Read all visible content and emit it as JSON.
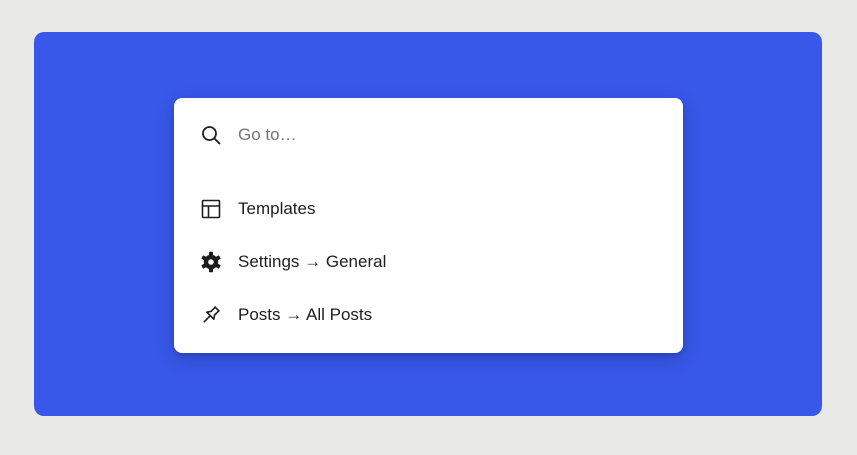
{
  "command_palette": {
    "search": {
      "placeholder": "Go to…",
      "value": ""
    },
    "results": [
      {
        "label": "Templates",
        "icon": "layout-icon"
      },
      {
        "label": "Settings → General",
        "icon": "gear-icon"
      },
      {
        "label": "Posts → All Posts",
        "icon": "pin-icon"
      }
    ]
  },
  "colors": {
    "background": "#e9e9e7",
    "canvas": "#3858e9",
    "panel": "#ffffff",
    "text": "#1e1e1e",
    "placeholder": "#757575"
  }
}
